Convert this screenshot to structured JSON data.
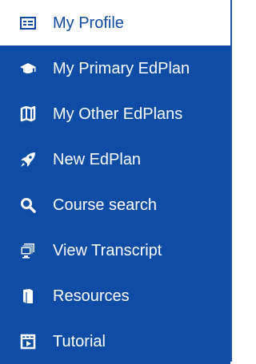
{
  "menu": {
    "items": [
      {
        "label": "My Profile",
        "icon": "id-card-icon",
        "state": "inactive"
      },
      {
        "label": "My Primary EdPlan",
        "icon": "graduation-cap-icon",
        "state": "active"
      },
      {
        "label": "My Other EdPlans",
        "icon": "map-icon",
        "state": "active"
      },
      {
        "label": "New EdPlan",
        "icon": "rocket-icon",
        "state": "active"
      },
      {
        "label": "Course search",
        "icon": "search-icon",
        "state": "active"
      },
      {
        "label": "View Transcript",
        "icon": "monitor-documents-icon",
        "state": "active"
      },
      {
        "label": "Resources",
        "icon": "book-icon",
        "state": "active"
      },
      {
        "label": "Tutorial",
        "icon": "video-icon",
        "state": "active"
      }
    ]
  },
  "colors": {
    "active_bg": "#0f4ca5",
    "active_text": "#ffffff",
    "inactive_bg": "#ffffff",
    "inactive_text": "#0d4aa0"
  }
}
